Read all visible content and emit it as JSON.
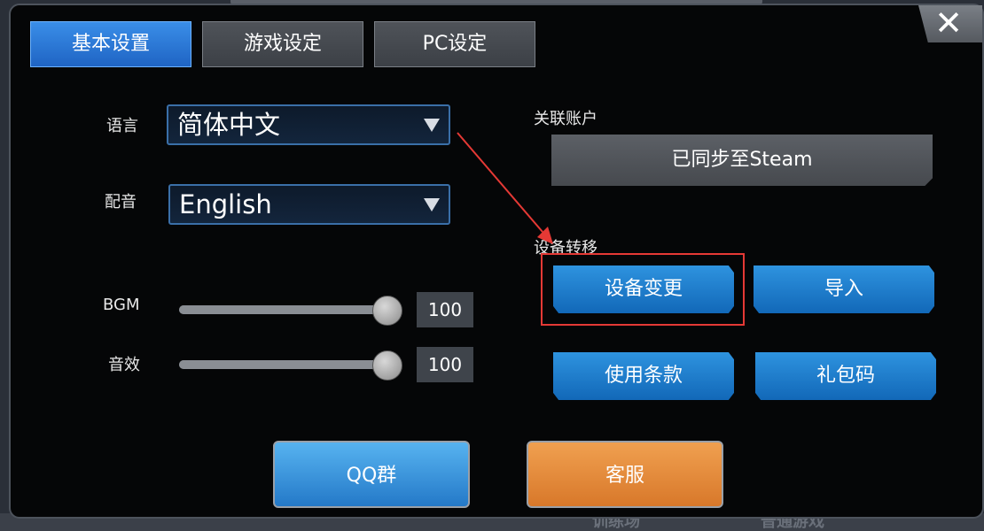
{
  "tabs": [
    {
      "label": "基本设置",
      "active": true
    },
    {
      "label": "游戏设定",
      "active": false
    },
    {
      "label": "PC设定",
      "active": false
    }
  ],
  "close_icon": "close-x-icon",
  "language": {
    "label": "语言",
    "value": "简体中文"
  },
  "voice": {
    "label": "配音",
    "value": "English"
  },
  "bgm": {
    "label": "BGM",
    "value": "100",
    "level": 100
  },
  "sfx": {
    "label": "音效",
    "value": "100",
    "level": 100
  },
  "account": {
    "label": "关联账户",
    "button": "已同步至Steam"
  },
  "device_transfer": {
    "label": "设备转移",
    "change_button": "设备变更",
    "import_button": "导入"
  },
  "terms_button": "使用条款",
  "gift_code_button": "礼包码",
  "qq_group_button": "QQ群",
  "support_button": "客服",
  "background_text": [
    "训练场",
    "普通游戏"
  ],
  "colors": {
    "accent_blue": "#1f64c4",
    "orange": "#e08a3a",
    "annotation_red": "#e53935"
  }
}
